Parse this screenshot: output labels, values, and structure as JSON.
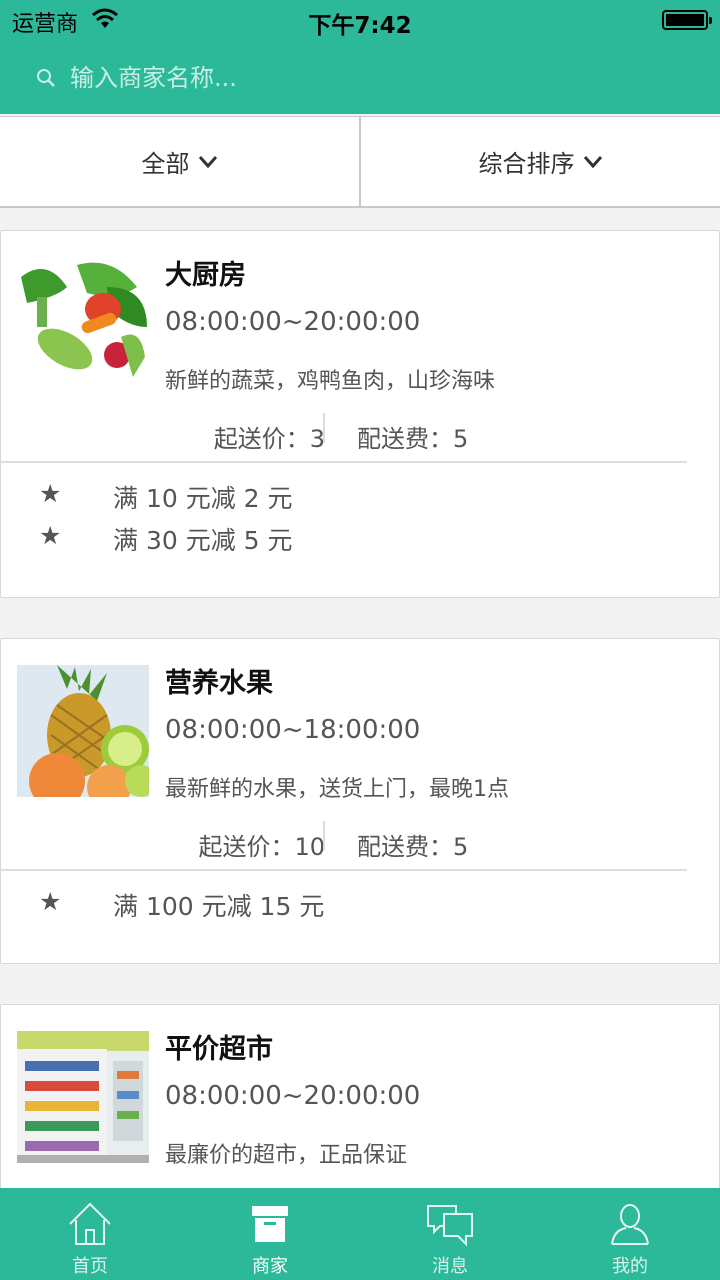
{
  "status_bar": {
    "carrier": "运营商",
    "time": "下午7:42"
  },
  "search": {
    "placeholder": "输入商家名称..."
  },
  "filters": {
    "category": "全部",
    "sort": "综合排序"
  },
  "merchants": [
    {
      "name": "大厨房",
      "hours": "08:00:00~20:00:00",
      "desc": "新鲜的蔬菜，鸡鸭鱼肉，山珍海味",
      "min_order": "起送价：3",
      "delivery_fee": "配送费：5",
      "promos": [
        {
          "icon": "★",
          "text": "满 10 元减 2 元"
        },
        {
          "icon": "★",
          "text": "满 30 元减 5 元"
        }
      ]
    },
    {
      "name": "营养水果",
      "hours": "08:00:00~18:00:00",
      "desc": "最新鲜的水果，送货上门，最晚1点",
      "min_order": "起送价：10",
      "delivery_fee": "配送费：5",
      "promos": [
        {
          "icon": "★",
          "text": "满 100 元减 15 元"
        }
      ]
    },
    {
      "name": "平价超市",
      "hours": "08:00:00~20:00:00",
      "desc": "最廉价的超市，正品保证"
    }
  ],
  "tabbar": {
    "items": [
      {
        "label": "首页",
        "icon": "home-icon"
      },
      {
        "label": "商家",
        "icon": "store-icon"
      },
      {
        "label": "消息",
        "icon": "message-icon"
      },
      {
        "label": "我的",
        "icon": "user-icon"
      }
    ],
    "active_index": 1
  },
  "colors": {
    "brand": "#2bb99a"
  }
}
